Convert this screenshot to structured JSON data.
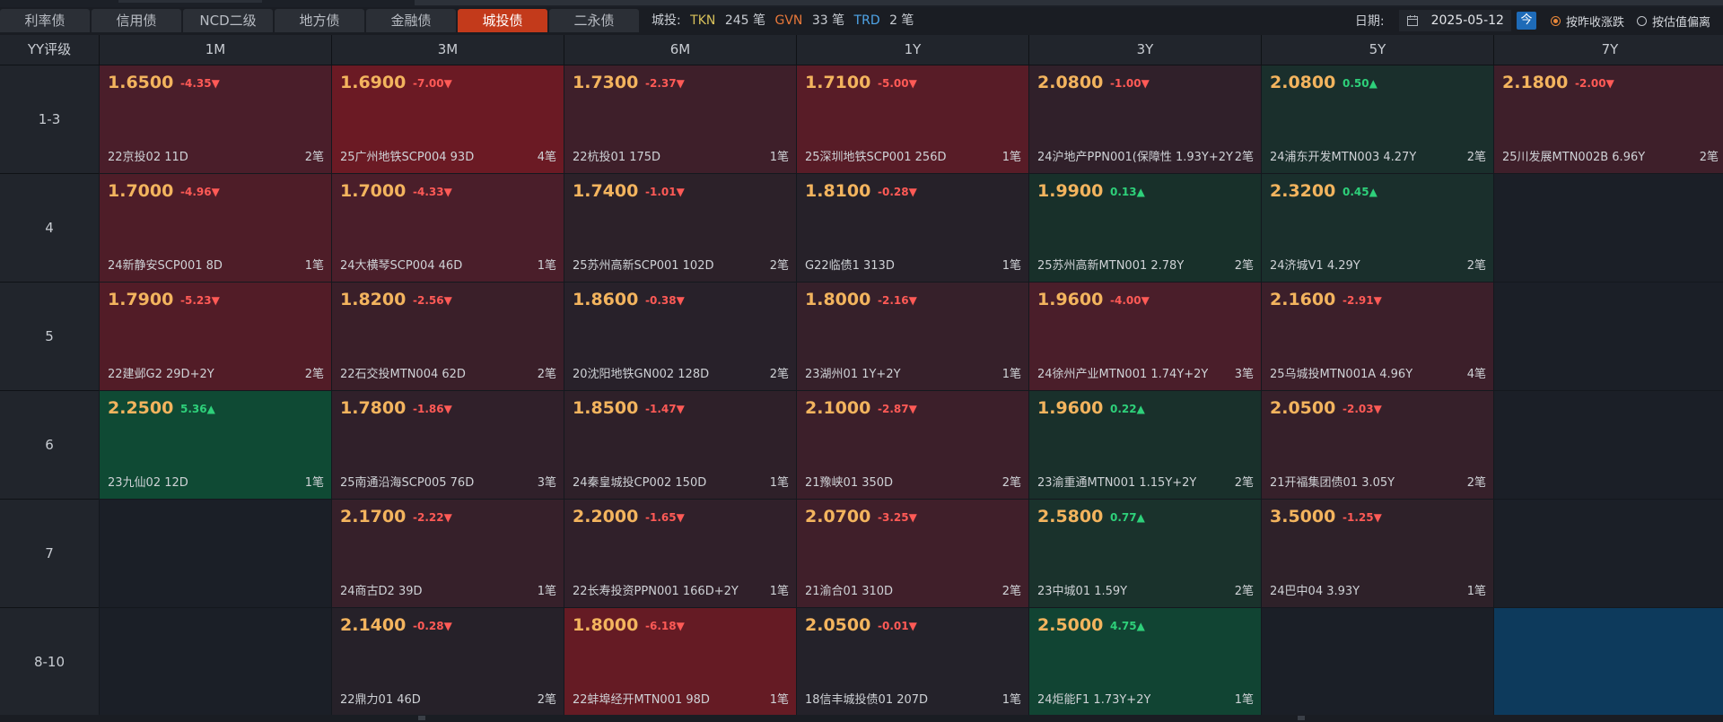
{
  "tabs": [
    {
      "label": "利率债",
      "active": false
    },
    {
      "label": "信用债",
      "active": false
    },
    {
      "label": "NCD二级",
      "active": false
    },
    {
      "label": "地方债",
      "active": false
    },
    {
      "label": "金融债",
      "active": false
    },
    {
      "label": "城投债",
      "active": true
    },
    {
      "label": "二永债",
      "active": false
    }
  ],
  "stats": {
    "label": "城投:",
    "tkn_label": "TKN",
    "tkn_count": "245 笔",
    "gvn_label": "GVN",
    "gvn_count": "33 笔",
    "trd_label": "TRD",
    "trd_count": "2 笔"
  },
  "controls": {
    "date_label": "日期:",
    "date_value": "2025-05-12",
    "today_button": "今",
    "radio_prev_close": "按昨收涨跌",
    "radio_valuation": "按估值偏离",
    "selected": "radio_prev_close"
  },
  "colors": {
    "active_tab": "#c33a1b",
    "tkn": "#d8c15a",
    "gvn": "#e8783a",
    "trd": "#4fa5e8",
    "down": "#ff5a56",
    "up": "#2ed07a",
    "yield": "#f3b45e",
    "empty_highlight": "#0d3a5c"
  },
  "grid": {
    "corner": "YY评级",
    "columns": [
      "1M",
      "3M",
      "6M",
      "1Y",
      "3Y",
      "5Y",
      "7Y"
    ],
    "rows": [
      {
        "label": "1-3",
        "cells": [
          {
            "yield": "1.6500",
            "change": "-4.35▼",
            "dir": "down",
            "bond": "22京投02 11D",
            "count": "2笔",
            "tone": "#4a1e2a"
          },
          {
            "yield": "1.6900",
            "change": "-7.00▼",
            "dir": "down",
            "bond": "25广州地铁SCP004 93D",
            "count": "4笔",
            "tone": "#6b1a24"
          },
          {
            "yield": "1.7300",
            "change": "-2.37▼",
            "dir": "down",
            "bond": "22杭投01 175D",
            "count": "1笔",
            "tone": "#3e1f2a"
          },
          {
            "yield": "1.7100",
            "change": "-5.00▼",
            "dir": "down",
            "bond": "25深圳地铁SCP001 256D",
            "count": "1笔",
            "tone": "#581c27"
          },
          {
            "yield": "2.0800",
            "change": "-1.00▼",
            "dir": "down",
            "bond": "24沪地产PPN001(保障性 1.93Y+2Y",
            "count": "2笔",
            "tone": "#30202a"
          },
          {
            "yield": "2.0800",
            "change": "0.50▲",
            "dir": "up",
            "bond": "24浦东开发MTN003 4.27Y",
            "count": "2笔",
            "tone": "#1a2f2c"
          },
          {
            "yield": "2.1800",
            "change": "-2.00▼",
            "dir": "down",
            "bond": "25川发展MTN002B 6.96Y",
            "count": "2笔",
            "tone": "#3e1f2a"
          }
        ]
      },
      {
        "label": "4",
        "cells": [
          {
            "yield": "1.7000",
            "change": "-4.96▼",
            "dir": "down",
            "bond": "24新静安SCP001 8D",
            "count": "1笔",
            "tone": "#4e1d28"
          },
          {
            "yield": "1.7000",
            "change": "-4.33▼",
            "dir": "down",
            "bond": "24大横琴SCP004 46D",
            "count": "1笔",
            "tone": "#4a1e2a"
          },
          {
            "yield": "1.7400",
            "change": "-1.01▼",
            "dir": "down",
            "bond": "25苏州高新SCP001 102D",
            "count": "2笔",
            "tone": "#2c2129"
          },
          {
            "yield": "1.8100",
            "change": "-0.28▼",
            "dir": "down",
            "bond": "G22临债1 313D",
            "count": "1笔",
            "tone": "#262129"
          },
          {
            "yield": "1.9900",
            "change": "0.13▲",
            "dir": "up",
            "bond": "25苏州高新MTN001 2.78Y",
            "count": "2笔",
            "tone": "#18302a"
          },
          {
            "yield": "2.3200",
            "change": "0.45▲",
            "dir": "up",
            "bond": "24济城V1 4.29Y",
            "count": "2笔",
            "tone": "#1a2f2c"
          },
          null
        ]
      },
      {
        "label": "5",
        "cells": [
          {
            "yield": "1.7900",
            "change": "-5.23▼",
            "dir": "down",
            "bond": "22建邺G2 29D+2Y",
            "count": "2笔",
            "tone": "#521c27"
          },
          {
            "yield": "1.8200",
            "change": "-2.56▼",
            "dir": "down",
            "bond": "22石交投MTN004 62D",
            "count": "2笔",
            "tone": "#3a1f29"
          },
          {
            "yield": "1.8600",
            "change": "-0.38▼",
            "dir": "down",
            "bond": "20沈阳地铁GN002 128D",
            "count": "2笔",
            "tone": "#28212a"
          },
          {
            "yield": "1.8000",
            "change": "-2.16▼",
            "dir": "down",
            "bond": "23湖州01 1Y+2Y",
            "count": "1笔",
            "tone": "#36202a"
          },
          {
            "yield": "1.9600",
            "change": "-4.00▼",
            "dir": "down",
            "bond": "24徐州产业MTN001 1.74Y+2Y",
            "count": "3笔",
            "tone": "#4a1e2a"
          },
          {
            "yield": "2.1600",
            "change": "-2.91▼",
            "dir": "down",
            "bond": "25乌城投MTN001A 4.96Y",
            "count": "4笔",
            "tone": "#3c1f2a"
          },
          null
        ]
      },
      {
        "label": "6",
        "cells": [
          {
            "yield": "2.2500",
            "change": "5.36▲",
            "dir": "up",
            "bond": "23九仙02 12D",
            "count": "1笔",
            "tone": "#0f4a34"
          },
          {
            "yield": "1.7800",
            "change": "-1.86▼",
            "dir": "down",
            "bond": "25南通沿海SCP005 76D",
            "count": "3笔",
            "tone": "#30202a"
          },
          {
            "yield": "1.8500",
            "change": "-1.47▼",
            "dir": "down",
            "bond": "24秦皇城投CP002 150D",
            "count": "1笔",
            "tone": "#2e2029"
          },
          {
            "yield": "2.1000",
            "change": "-2.87▼",
            "dir": "down",
            "bond": "21豫峡01 350D",
            "count": "2笔",
            "tone": "#3c1f2a"
          },
          {
            "yield": "1.9600",
            "change": "0.22▲",
            "dir": "up",
            "bond": "23渝重通MTN001 1.15Y+2Y",
            "count": "2笔",
            "tone": "#19302b"
          },
          {
            "yield": "2.0500",
            "change": "-2.03▼",
            "dir": "down",
            "bond": "21开福集团债01 3.05Y",
            "count": "2笔",
            "tone": "#36202a"
          },
          null
        ]
      },
      {
        "label": "7",
        "cells": [
          null,
          {
            "yield": "2.1700",
            "change": "-2.22▼",
            "dir": "down",
            "bond": "24商古D2 39D",
            "count": "1笔",
            "tone": "#36202a"
          },
          {
            "yield": "2.2000",
            "change": "-1.65▼",
            "dir": "down",
            "bond": "22长寿投资PPN001 166D+2Y",
            "count": "1笔",
            "tone": "#30202a"
          },
          {
            "yield": "2.0700",
            "change": "-3.25▼",
            "dir": "down",
            "bond": "21渝合01 310D",
            "count": "2笔",
            "tone": "#401f2a"
          },
          {
            "yield": "2.5800",
            "change": "0.77▲",
            "dir": "up",
            "bond": "23中城01 1.59Y",
            "count": "2笔",
            "tone": "#1a322c"
          },
          {
            "yield": "3.5000",
            "change": "-1.25▼",
            "dir": "down",
            "bond": "24巴中04 3.93Y",
            "count": "1笔",
            "tone": "#2e2129"
          },
          null
        ]
      },
      {
        "label": "8-10",
        "cells": [
          null,
          {
            "yield": "2.1400",
            "change": "-0.28▼",
            "dir": "down",
            "bond": "22鼎力01 46D",
            "count": "2笔",
            "tone": "#262129"
          },
          {
            "yield": "1.8000",
            "change": "-6.18▼",
            "dir": "down",
            "bond": "22蚌埠经开MTN001 98D",
            "count": "1笔",
            "tone": "#651b24"
          },
          {
            "yield": "2.0500",
            "change": "-0.01▼",
            "dir": "down",
            "bond": "18信丰城投债01 207D",
            "count": "1笔",
            "tone": "#24222a"
          },
          {
            "yield": "2.5000",
            "change": "4.75▲",
            "dir": "up",
            "bond": "24炬能F1 1.73Y+2Y",
            "count": "1笔",
            "tone": "#114433"
          },
          null,
          "highlight"
        ]
      }
    ]
  }
}
